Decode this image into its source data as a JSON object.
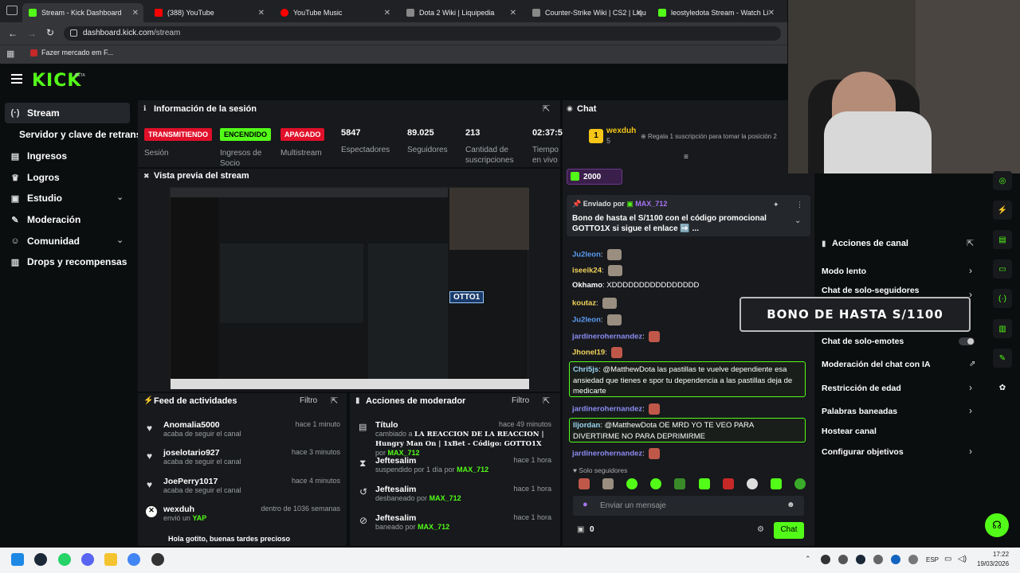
{
  "browser": {
    "tabs": [
      {
        "title": "Stream - Kick Dashboard",
        "color": "#53fc18"
      },
      {
        "title": "(388) YouTube",
        "color": "#ff0000"
      },
      {
        "title": "YouTube Music",
        "color": "#ff0000"
      },
      {
        "title": "Dota 2 Wiki | Liquipedia",
        "color": "#888888"
      },
      {
        "title": "Counter-Strike Wiki | CS2 | Liqu",
        "color": "#888888"
      },
      {
        "title": "leostyledota Stream - Watch Li",
        "color": "#53fc18"
      }
    ],
    "url_domain": "dashboard.kick.com",
    "url_path": "/stream",
    "bookmark": "Fazer mercado em F..."
  },
  "brand": {
    "logo": "KICK",
    "beta": "BETA",
    "accent": "#53fc18"
  },
  "sidebar": {
    "items": [
      {
        "label": "Stream",
        "icon": "live-icon"
      },
      {
        "label": "Servidor y clave de retransm",
        "icon": ""
      },
      {
        "label": "Ingresos",
        "icon": "revenue-icon"
      },
      {
        "label": "Logros",
        "icon": "trophy-icon"
      },
      {
        "label": "Estudio",
        "icon": "studio-icon"
      },
      {
        "label": "Moderación",
        "icon": "wrench-icon"
      },
      {
        "label": "Comunidad",
        "icon": "people-icon"
      },
      {
        "label": "Drops y recompensas",
        "icon": "gift-icon"
      }
    ]
  },
  "session": {
    "title": "Información de la sesión",
    "badges": {
      "live": "TRANSMITIENDO",
      "on": "ENCENDIDO",
      "off": "APAGADO"
    },
    "labels": {
      "session": "Sesión",
      "revenue": "Ingresos de Socio",
      "multistream": "Multistream",
      "viewers": "Espectadores",
      "followers": "Seguidores",
      "subs": "Cantidad de suscripciones",
      "uptime": "Tiempo en vivo"
    },
    "values": {
      "viewers": "5847",
      "followers": "89.025",
      "subs": "213",
      "uptime": "02:37:5"
    }
  },
  "preview": {
    "title": "Vista previa del stream",
    "overlay": "OTTO1"
  },
  "feed": {
    "title": "Feed de actividades",
    "filter": "Filtro",
    "items": [
      {
        "name": "Anomalia5000",
        "desc": "acaba de seguir el canal",
        "time": "hace 1 minuto"
      },
      {
        "name": "joselotario927",
        "desc": "acaba de seguir el canal",
        "time": "hace 3 minutos"
      },
      {
        "name": "JoePerry1017",
        "desc": "acaba de seguir el canal",
        "time": "hace 4 minutos"
      },
      {
        "name": "wexduh",
        "desc": "envió un",
        "extra": "YAP",
        "time": "dentro de 1036 semanas"
      }
    ],
    "tail": "Hola gotito, buenas tardes precioso"
  },
  "mod": {
    "title": "Acciones de moderador",
    "filter": "Filtro",
    "items": [
      {
        "name": "Título",
        "pre": "cambiado a",
        "bold": "LA REACCION DE LA REACCION | Hungry Man On | 1xBet - Código: GOTTO1X",
        "mid": "por",
        "by": "MAX_712",
        "time": "hace 49 minutos"
      },
      {
        "name": "Jeftesalim",
        "pre": "suspendido por 1 día por",
        "by": "MAX_712",
        "time": "hace 1 hora"
      },
      {
        "name": "Jeftesalim",
        "pre": "desbaneado por",
        "by": "MAX_712",
        "time": "hace 1 hora"
      },
      {
        "name": "Jeftesalim",
        "pre": "baneado por",
        "by": "MAX_712",
        "time": "hace 1 hora"
      }
    ]
  },
  "chat": {
    "title": "Chat",
    "top_user": "wexduh",
    "top_amount": "5",
    "top_rank": "1",
    "gift_text": "Regala 1 suscripción para tomar la posición 2",
    "kicks": "2000",
    "pinned_by_label": "Enviado por",
    "pinned_by": "MAX_712",
    "pinned_msg": "Bono de hasta el S/1100 con el código promocional GOTTO1X si sigue el enlace ➡️ ...",
    "messages": [
      {
        "user": "Ju2leon",
        "color": "#5b9cf2",
        "text": ""
      },
      {
        "user": "iseeik24",
        "color": "#f2d35b",
        "text": ""
      },
      {
        "user": "Okhamo",
        "color": "#ffffff",
        "text": "XDDDDDDDDDDDDDDDD"
      },
      {
        "user": "koutaz",
        "color": "#f2d35b",
        "text": ""
      },
      {
        "user": "Ju2leon",
        "color": "#5b9cf2",
        "text": ""
      },
      {
        "user": "jardinerohernandez",
        "color": "#8c8cf2",
        "text": ""
      },
      {
        "user": "Jhonel19",
        "color": "#f2d35b",
        "text": ""
      },
      {
        "user": "Chri5js",
        "color": "#9ad3f2",
        "text": "@MatthewDota las pastillas te vuelve dependiente esa ansiedad que tienes e spor tu dependencia a las pastillas deja de medicarte"
      },
      {
        "user": "jardinerohernandez",
        "color": "#8c8cf2",
        "text": ""
      },
      {
        "user": "lljordan",
        "color": "#9ad3f2",
        "text": "@MatthewDota OE MRD YO TE VEO PARA DIVERTIRME NO PARA DEPRIMIRME"
      },
      {
        "user": "jardinerohernandez",
        "color": "#8c8cf2",
        "text": ""
      }
    ],
    "followers_only": "Solo seguidores",
    "placeholder": "Enviar un mensaje",
    "send": "Chat",
    "points": "0"
  },
  "channel_actions": {
    "title": "Acciones de canal",
    "items": [
      "Modo lento",
      "Chat de solo-seguidores",
      "Chat de solo-emotes",
      "Moderación del chat con IA",
      "Restricción de edad",
      "Palabras baneadas",
      "Hostear canal",
      "Configurar objetivos"
    ]
  },
  "overlay_banner": "BONO DE HASTA S/1100",
  "system": {
    "lang": "ESP",
    "time": "17:22",
    "date": "19/03/2026"
  }
}
